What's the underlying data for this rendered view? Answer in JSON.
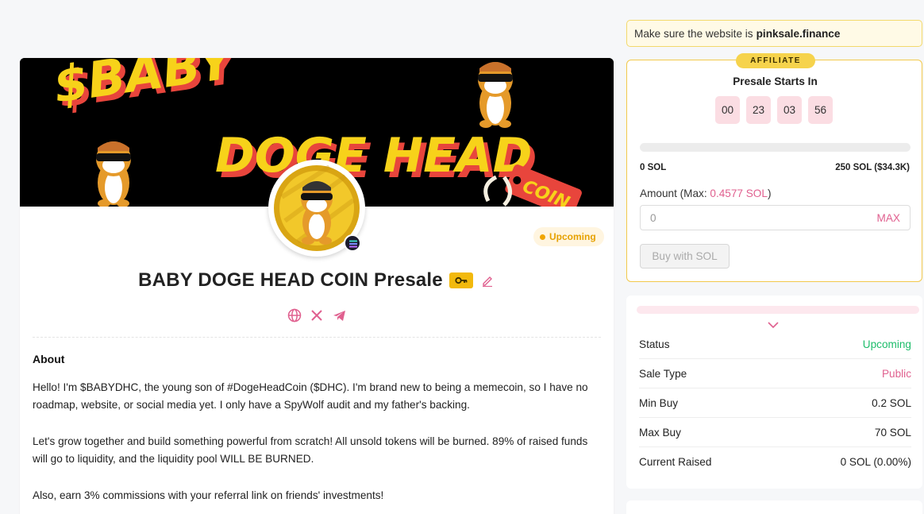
{
  "banner": {
    "line1": "$BABY",
    "line2": "DOGE HEAD",
    "tag": "COIN"
  },
  "project": {
    "status": "Upcoming",
    "title": "BABY DOGE HEAD COIN Presale"
  },
  "about": {
    "heading": "About",
    "paragraphs": [
      "Hello! I'm $BABYDHC, the young son of #DogeHeadCoin ($DHC). I'm brand new to being a memecoin, so I have no roadmap, website, or social media yet. I only have a SpyWolf audit and my father's backing.",
      "Let's grow together and build something powerful from scratch! All unsold tokens will be burned. 89% of raised funds will go to liquidity, and the liquidity pool WILL BE BURNED.",
      "Also, earn 3% commissions with your referral link on friends' investments!"
    ]
  },
  "notice": {
    "text": "Make sure the website is",
    "domain": "pinksale.finance"
  },
  "presale": {
    "affiliate_label": "AFFILIATE",
    "starts_label": "Presale Starts In",
    "countdown": [
      "00",
      "23",
      "03",
      "56"
    ],
    "progress_percent": 0,
    "raised_left": "0 SOL",
    "raised_right": "250 SOL ($34.3K)",
    "amount_label_prefix": "Amount (Max: ",
    "amount_max": "0.4577 SOL",
    "amount_label_suffix": ")",
    "amount_placeholder": "0",
    "max_button": "MAX",
    "buy_button": "Buy with SOL"
  },
  "info": {
    "rows": [
      {
        "label": "Status",
        "value": "Upcoming"
      },
      {
        "label": "Sale Type",
        "value": "Public"
      },
      {
        "label": "Min Buy",
        "value": "0.2 SOL"
      },
      {
        "label": "Max Buy",
        "value": "70 SOL"
      },
      {
        "label": "Current Raised",
        "value": "0 SOL (0.00%)"
      }
    ]
  },
  "colors": {
    "accent_pink": "#e0608f",
    "status_green": "#1ebd6b",
    "affiliate_yellow": "#f6d34c",
    "banner_yellow": "#f7d21a",
    "banner_red": "#e8453c"
  }
}
